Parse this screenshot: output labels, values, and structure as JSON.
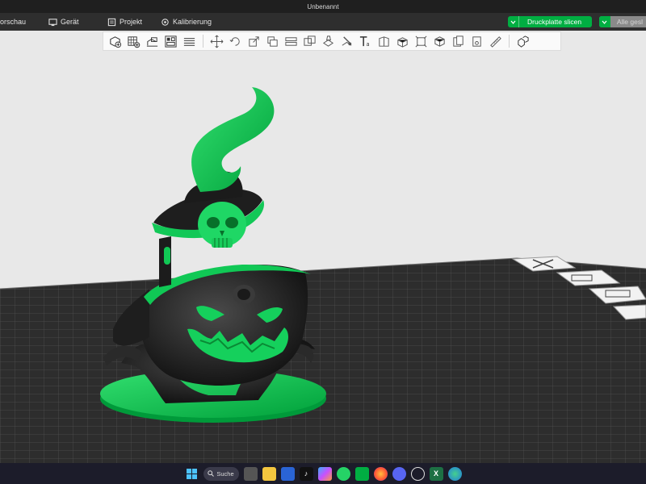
{
  "window": {
    "title": "Unbenannt"
  },
  "menubar": {
    "items": [
      {
        "label": "orschau",
        "icon": "preview-icon"
      },
      {
        "label": "Gerät",
        "icon": "device-icon"
      },
      {
        "label": "Projekt",
        "icon": "project-icon"
      },
      {
        "label": "Kalibrierung",
        "icon": "calibration-icon"
      }
    ],
    "slice_button": "Druckplatte slicen",
    "slice_all_button": "Alle gesl"
  },
  "toolbar": {
    "groups": [
      [
        "add-object-icon",
        "add-plate-icon",
        "auto-orient-icon",
        "arrange-icon",
        "slice-plates-icon"
      ],
      [
        "move-icon",
        "rotate-icon",
        "scale-icon",
        "lay-on-face-icon",
        "cut-icon",
        "boolean-icon",
        "support-paint-icon",
        "seam-paint-icon",
        "text-icon",
        "measure-icon",
        "assembly-icon",
        "fdm-icon",
        "cube-icon",
        "variable-layer-icon",
        "brim-ears-icon",
        "ruler-icon"
      ],
      [
        "split-objects-icon"
      ]
    ]
  },
  "viewport": {
    "background": "#e8e8e8",
    "plate_color": "#2e2e2e",
    "accent_green": "#00ae42"
  },
  "taskbar": {
    "search_label": "Suche",
    "icons": [
      "windows-start-icon",
      "search-icon",
      "task-view-icon",
      "file-explorer-icon",
      "store-icon",
      "tiktok-icon",
      "copilot-icon",
      "whatsapp-icon",
      "bambu-studio-icon",
      "firefox-icon",
      "discord-icon",
      "chatgpt-icon",
      "excel-icon",
      "edge-icon"
    ]
  }
}
